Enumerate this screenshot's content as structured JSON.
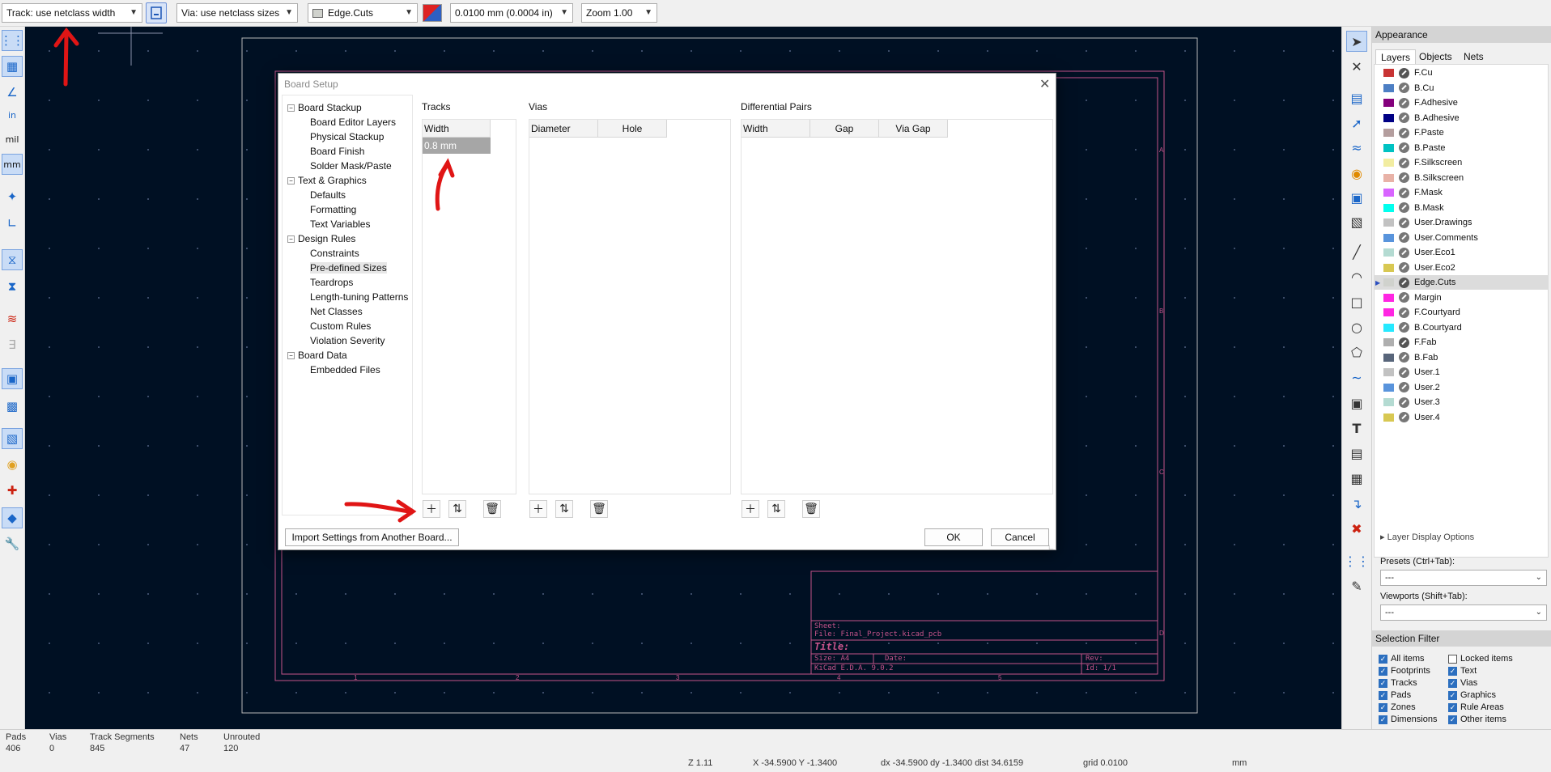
{
  "toolbar": {
    "track_width": "Track: use netclass width",
    "via_size": "Via: use netclass sizes",
    "active_layer": "Edge.Cuts",
    "grid": "0.0100 mm (0.0004 in)",
    "zoom": "Zoom 1.00"
  },
  "dialog": {
    "title": "Board Setup",
    "tree": [
      {
        "label": "Board Stackup",
        "level": 0
      },
      {
        "label": "Board Editor Layers",
        "level": 1
      },
      {
        "label": "Physical Stackup",
        "level": 1
      },
      {
        "label": "Board Finish",
        "level": 1
      },
      {
        "label": "Solder Mask/Paste",
        "level": 1
      },
      {
        "label": "Text & Graphics",
        "level": 0
      },
      {
        "label": "Defaults",
        "level": 1
      },
      {
        "label": "Formatting",
        "level": 1
      },
      {
        "label": "Text Variables",
        "level": 1
      },
      {
        "label": "Design Rules",
        "level": 0
      },
      {
        "label": "Constraints",
        "level": 1
      },
      {
        "label": "Pre-defined Sizes",
        "level": 1
      },
      {
        "label": "Teardrops",
        "level": 1
      },
      {
        "label": "Length-tuning Patterns",
        "level": 1
      },
      {
        "label": "Net Classes",
        "level": 1
      },
      {
        "label": "Custom Rules",
        "level": 1
      },
      {
        "label": "Violation Severity",
        "level": 1
      },
      {
        "label": "Board Data",
        "level": 0
      },
      {
        "label": "Embedded Files",
        "level": 1
      }
    ],
    "tracks": {
      "label": "Tracks",
      "columns": [
        "Width"
      ],
      "rows": [
        "0.8 mm"
      ]
    },
    "vias": {
      "label": "Vias",
      "columns": [
        "Diameter",
        "Hole"
      ]
    },
    "diff_pairs": {
      "label": "Differential Pairs",
      "columns": [
        "Width",
        "Gap",
        "Via Gap"
      ]
    },
    "import_button": "Import Settings from Another Board...",
    "ok_button": "OK",
    "cancel_button": "Cancel"
  },
  "title_block": {
    "sheet": "Sheet:",
    "file": "File: Final_Project.kicad_pcb",
    "title": "Title:",
    "size": "Size: A4",
    "date": "Date:",
    "rev": "Rev:",
    "tool": "KiCad E.D.A. 9.0.2",
    "id": "Id: 1/1",
    "columns": [
      "1",
      "2",
      "3",
      "4",
      "5"
    ],
    "rows": [
      "A",
      "B",
      "C",
      "D"
    ]
  },
  "appearance": {
    "title": "Appearance",
    "tabs": [
      "Layers",
      "Objects",
      "Nets"
    ],
    "layers": [
      {
        "name": "F.Cu",
        "color": "#c83434",
        "visible": true
      },
      {
        "name": "B.Cu",
        "color": "#4d7fc4",
        "visible": false
      },
      {
        "name": "F.Adhesive",
        "color": "#84007c",
        "visible": false
      },
      {
        "name": "B.Adhesive",
        "color": "#000084",
        "visible": false
      },
      {
        "name": "F.Paste",
        "color": "#b49e9e",
        "visible": false
      },
      {
        "name": "B.Paste",
        "color": "#00c2c2",
        "visible": false
      },
      {
        "name": "F.Silkscreen",
        "color": "#f2eda1",
        "visible": false
      },
      {
        "name": "B.Silkscreen",
        "color": "#e8b2a7",
        "visible": false
      },
      {
        "name": "F.Mask",
        "color": "#d864ff",
        "visible": false
      },
      {
        "name": "B.Mask",
        "color": "#02ffee",
        "visible": false
      },
      {
        "name": "User.Drawings",
        "color": "#c2c2c2",
        "visible": false
      },
      {
        "name": "User.Comments",
        "color": "#5994dc",
        "visible": false
      },
      {
        "name": "User.Eco1",
        "color": "#b4dbd2",
        "visible": false
      },
      {
        "name": "User.Eco2",
        "color": "#d8c852",
        "visible": false
      },
      {
        "name": "Edge.Cuts",
        "color": "#d0d2cd",
        "visible": true,
        "selected": true
      },
      {
        "name": "Margin",
        "color": "#ff26e2",
        "visible": false
      },
      {
        "name": "F.Courtyard",
        "color": "#ff26e2",
        "visible": false
      },
      {
        "name": "B.Courtyard",
        "color": "#26e9ff",
        "visible": false
      },
      {
        "name": "F.Fab",
        "color": "#afafaf",
        "visible": true
      },
      {
        "name": "B.Fab",
        "color": "#58657a",
        "visible": false
      },
      {
        "name": "User.1",
        "color": "#c2c2c2",
        "visible": false
      },
      {
        "name": "User.2",
        "color": "#5994dc",
        "visible": false
      },
      {
        "name": "User.3",
        "color": "#b4dbd2",
        "visible": false
      },
      {
        "name": "User.4",
        "color": "#d8c852",
        "visible": false
      }
    ],
    "layer_display_options": "Layer Display Options",
    "presets_label": "Presets (Ctrl+Tab):",
    "presets_value": "---",
    "viewports_label": "Viewports (Shift+Tab):",
    "viewports_value": "---"
  },
  "selection_filter": {
    "title": "Selection Filter",
    "items": [
      {
        "label": "All items",
        "checked": true
      },
      {
        "label": "Locked items",
        "checked": false
      },
      {
        "label": "Footprints",
        "checked": true
      },
      {
        "label": "Text",
        "checked": true
      },
      {
        "label": "Tracks",
        "checked": true
      },
      {
        "label": "Vias",
        "checked": true
      },
      {
        "label": "Pads",
        "checked": true
      },
      {
        "label": "Graphics",
        "checked": true
      },
      {
        "label": "Zones",
        "checked": true
      },
      {
        "label": "Rule Areas",
        "checked": true
      },
      {
        "label": "Dimensions",
        "checked": true
      },
      {
        "label": "Other items",
        "checked": true
      }
    ]
  },
  "left_toolbar": {
    "inch_label": "in",
    "mil_label": "mil",
    "mm_label": "mm"
  },
  "status": {
    "stats": [
      {
        "label": "Pads",
        "value": "406"
      },
      {
        "label": "Vias",
        "value": "0"
      },
      {
        "label": "Track Segments",
        "value": "845"
      },
      {
        "label": "Nets",
        "value": "47"
      },
      {
        "label": "Unrouted",
        "value": "120"
      }
    ],
    "zoom": "Z 1.11",
    "xy": "X -34.5900  Y -1.3400",
    "delta": "dx -34.5900  dy -1.3400  dist 34.6159",
    "grid": "grid 0.0100",
    "units": "mm"
  },
  "colors": {
    "canvas": "#001023",
    "sheet_border": "#c4538a",
    "annotation": "#e01515"
  }
}
